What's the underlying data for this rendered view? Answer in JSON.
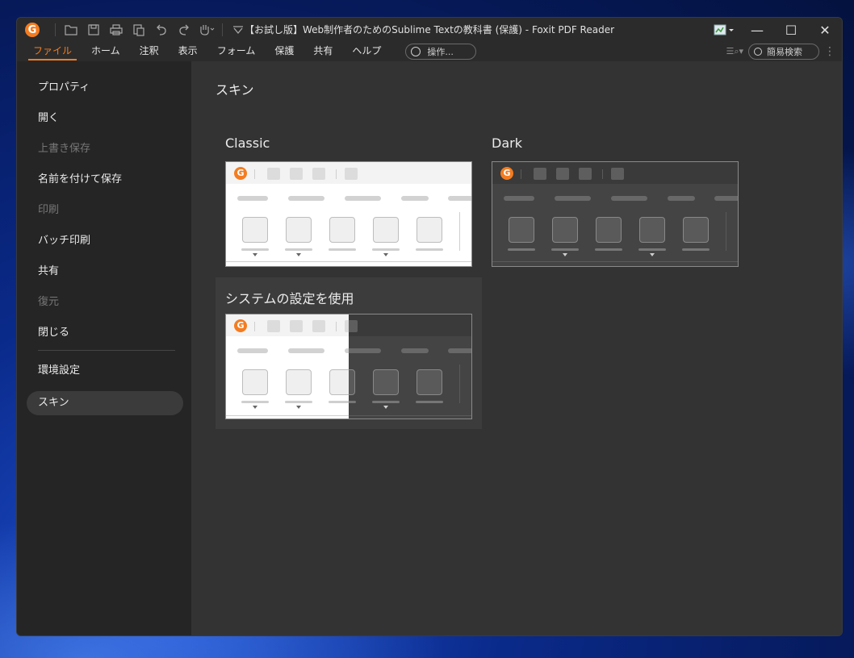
{
  "window": {
    "title": "【お試し版】Web制作者のためのSublime Textの教科書 (保護) - Foxit PDF Reader"
  },
  "quick_access": {
    "logo_letter": "G",
    "icons": [
      "open-icon",
      "save-icon",
      "print-icon",
      "copy-icon",
      "undo-icon",
      "redo-icon",
      "hand-icon",
      "customize-icon"
    ]
  },
  "window_controls": {
    "minimize": "—",
    "maximize": "☐",
    "close": "✕"
  },
  "menu": {
    "items": [
      "ファイル",
      "ホーム",
      "注釈",
      "表示",
      "フォーム",
      "保護",
      "共有",
      "ヘルプ"
    ],
    "tell_me": "操作...",
    "search": "簡易検索"
  },
  "sidebar": {
    "items": [
      {
        "label": "プロパティ",
        "state": "normal"
      },
      {
        "label": "開く",
        "state": "normal"
      },
      {
        "label": "上書き保存",
        "state": "disabled"
      },
      {
        "label": "名前を付けて保存",
        "state": "normal"
      },
      {
        "label": "印刷",
        "state": "disabled"
      },
      {
        "label": "バッチ印刷",
        "state": "normal"
      },
      {
        "label": "共有",
        "state": "normal"
      },
      {
        "label": "復元",
        "state": "disabled"
      },
      {
        "label": "閉じる",
        "state": "normal"
      },
      {
        "label": "環境設定",
        "state": "normal"
      },
      {
        "label": "スキン",
        "state": "selected"
      }
    ]
  },
  "main": {
    "title": "スキン",
    "skins": [
      {
        "label": "Classic",
        "theme": "light",
        "selected": false
      },
      {
        "label": "Dark",
        "theme": "dark",
        "selected": false
      },
      {
        "label": "システムの設定を使用",
        "theme": "split",
        "selected": true
      }
    ]
  },
  "colors": {
    "accent": "#f47c20",
    "window_bg": "#2b2b2b",
    "sidebar_bg": "#252525",
    "main_bg": "#333333"
  }
}
